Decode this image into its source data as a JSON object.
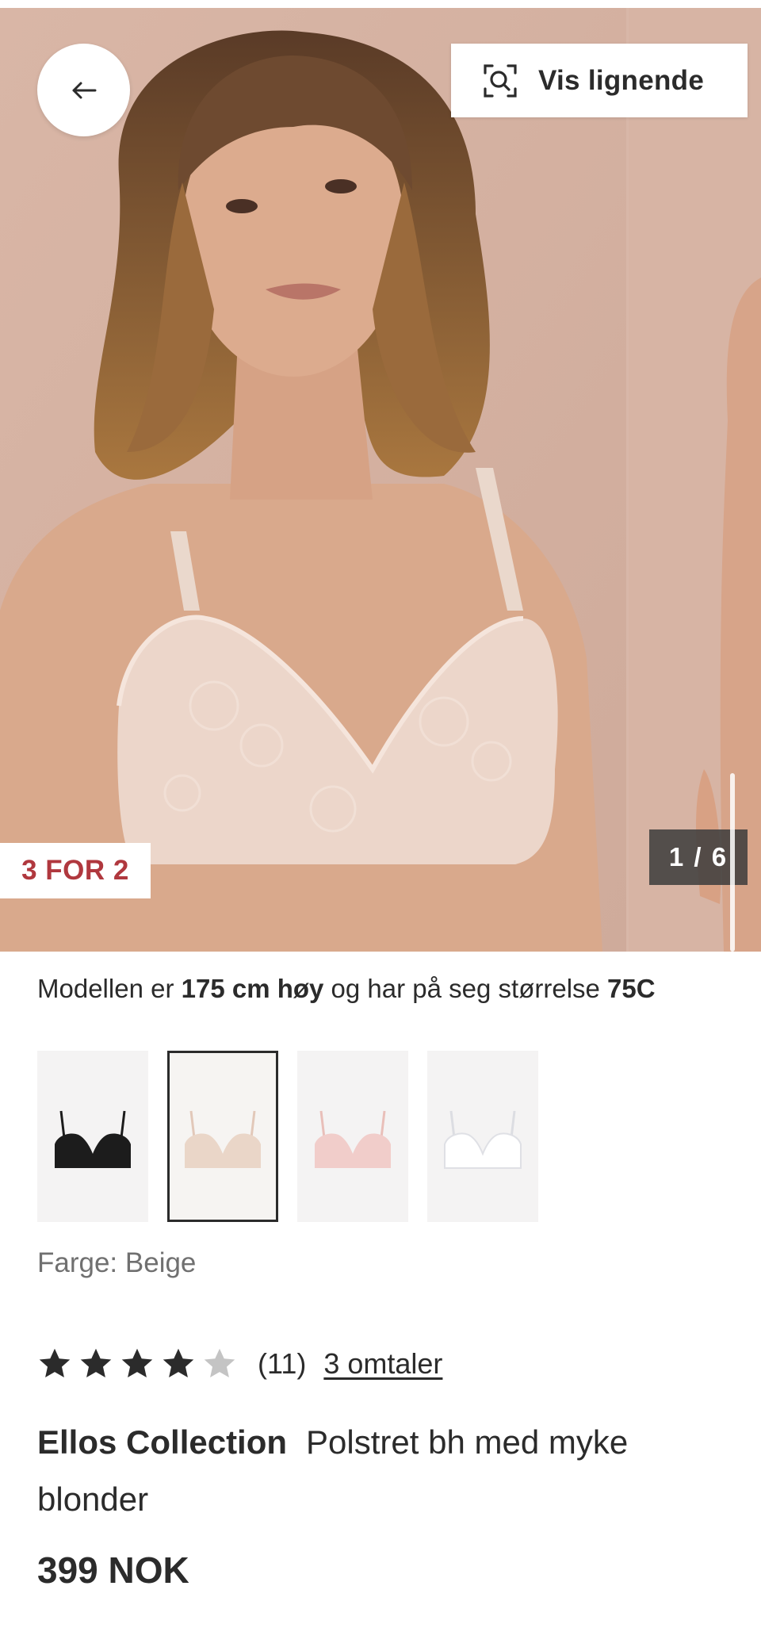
{
  "gallery": {
    "similar_label": "Vis lignende",
    "promo_badge": "3 FOR 2",
    "counter": "1 / 6",
    "current_image": 1,
    "total_images": 6
  },
  "model_info": {
    "prefix": "Modellen er ",
    "height": "175 cm høy",
    "middle": " og har på seg størrelse ",
    "size": "75C"
  },
  "swatches": [
    {
      "color": "#1c1c1c",
      "selected": false
    },
    {
      "color": "#ead6c8",
      "selected": true
    },
    {
      "color": "#f1cdca",
      "selected": false
    },
    {
      "color": "#f2f2f4",
      "selected": false
    }
  ],
  "color_line": "Farge: Beige",
  "rating": {
    "stars": 4,
    "max_stars": 5,
    "count": "(11)",
    "reviews_link": "3 omtaler"
  },
  "product": {
    "brand": "Ellos Collection",
    "name": "Polstret bh med myke blonder",
    "price": "399 NOK"
  },
  "colors": {
    "text": "#2b2b2b",
    "muted": "#707070",
    "promo": "#b0383e",
    "backdrop": "#d8b7a8"
  }
}
